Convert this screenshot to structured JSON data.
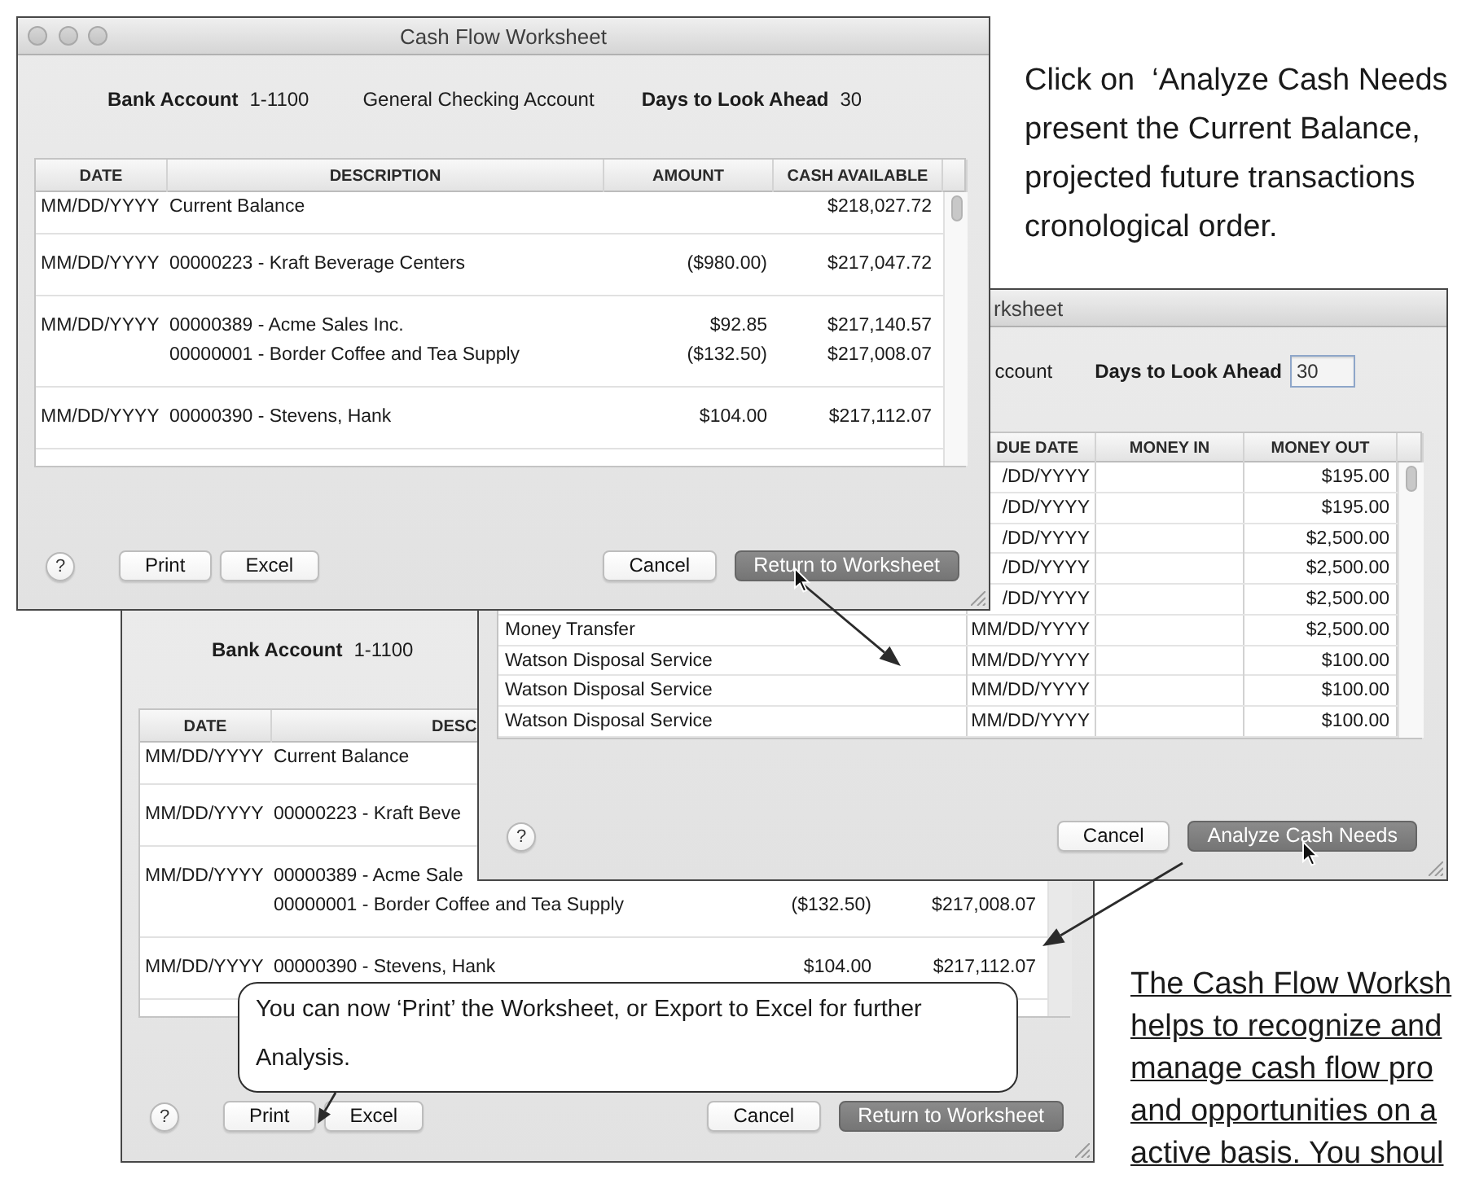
{
  "instruction": {
    "lines": [
      "Click on  ‘Analyze Cash Needs",
      "present the Current Balance,",
      "projected future transactions",
      "cronological order."
    ]
  },
  "worksheet_window": {
    "title": "Cash Flow Worksheet",
    "bank_account_label": "Bank Account",
    "bank_account_number": "1-1100",
    "account_name": "General Checking Account",
    "days_label": "Days to Look Ahead",
    "days_value": "30",
    "columns": [
      "DATE",
      "DESCRIPTION",
      "AMOUNT",
      "CASH AVAILABLE"
    ],
    "rows": [
      {
        "date": "MM/DD/YYYY",
        "entries": [
          {
            "description": "Current Balance",
            "cash_available": "$218,027.72"
          }
        ]
      },
      {
        "date": "MM/DD/YYYY",
        "entries": [
          {
            "description": "00000223 - Kraft Beverage Centers",
            "amount": "($980.00)",
            "cash_available": "$217,047.72"
          }
        ]
      },
      {
        "date": "MM/DD/YYYY",
        "entries": [
          {
            "description": "00000389 - Acme Sales Inc.",
            "amount": "$92.85",
            "cash_available": "$217,140.57"
          },
          {
            "description": "00000001 - Border Coffee and Tea Supply",
            "amount": "($132.50)",
            "cash_available": "$217,008.07"
          }
        ]
      },
      {
        "date": "MM/DD/YYYY",
        "entries": [
          {
            "description": "00000390 - Stevens, Hank",
            "amount": "$104.00",
            "cash_available": "$217,112.07"
          }
        ]
      }
    ],
    "buttons_left": [
      {
        "label": "?",
        "kind": "help"
      },
      {
        "label": "Print",
        "kind": "push"
      },
      {
        "label": "Excel",
        "kind": "push"
      }
    ],
    "buttons_right": [
      {
        "label": "Cancel",
        "kind": "push"
      },
      {
        "label": "Return to Worksheet",
        "kind": "default"
      }
    ]
  },
  "analysis_window": {
    "title": "rksheet",
    "account_name": "ccount",
    "days_label": "Days to Look Ahead",
    "days_value": "30",
    "columns": [
      "DUE DATE",
      "MONEY IN",
      "MONEY OUT"
    ],
    "rows": [
      {
        "due_date": "/DD/YYYY",
        "money_out": "$195.00"
      },
      {
        "due_date": "/DD/YYYY",
        "money_out": "$195.00"
      },
      {
        "due_date": "/DD/YYYY",
        "money_out": "$2,500.00"
      },
      {
        "due_date": "/DD/YYYY",
        "money_out": "$2,500.00"
      },
      {
        "due_date": "/DD/YYYY",
        "money_out": "$2,500.00"
      },
      {
        "description": "Money Transfer",
        "due_date": "MM/DD/YYYY",
        "money_out": "$2,500.00"
      },
      {
        "description": "Watson Disposal Service",
        "due_date": "MM/DD/YYYY",
        "money_out": "$100.00"
      },
      {
        "description": "Watson Disposal Service",
        "due_date": "MM/DD/YYYY",
        "money_out": "$100.00"
      },
      {
        "description": "Watson Disposal Service",
        "due_date": "MM/DD/YYYY",
        "money_out": "$100.00"
      }
    ],
    "buttons_left": [
      {
        "label": "?",
        "kind": "help"
      }
    ],
    "buttons_right": [
      {
        "label": "Cancel",
        "kind": "push"
      },
      {
        "label": "Analyze Cash Needs",
        "kind": "default"
      }
    ]
  },
  "lower_window": {
    "bank_account_label": "Bank Account",
    "bank_account_number": "1-1100",
    "columns": [
      "DATE",
      "DESC"
    ],
    "rows": [
      {
        "date": "MM/DD/YYYY",
        "entries": [
          {
            "description": "Current Balance"
          }
        ]
      },
      {
        "date": "MM/DD/YYYY",
        "entries": [
          {
            "description": "00000223 - Kraft Beve"
          }
        ]
      },
      {
        "date": "MM/DD/YYYY",
        "entries": [
          {
            "description": "00000389 - Acme Sale"
          },
          {
            "description": "00000001 - Border Coffee and Tea Supply",
            "amount": "($132.50)",
            "cash_available": "$217,008.07"
          }
        ]
      },
      {
        "date": "MM/DD/YYYY",
        "entries": [
          {
            "description": "00000390 - Stevens, Hank",
            "amount": "$104.00",
            "cash_available": "$217,112.07"
          }
        ]
      }
    ],
    "buttons_left": [
      {
        "label": "?",
        "kind": "help"
      },
      {
        "label": "Print",
        "kind": "push"
      },
      {
        "label": "Excel",
        "kind": "push"
      }
    ],
    "buttons_right": [
      {
        "label": "Cancel",
        "kind": "push"
      },
      {
        "label": "Return to Worksheet",
        "kind": "default"
      }
    ]
  },
  "callout": {
    "text": "You can now ‘Print’ the Worksheet, or Export to Excel for further Analysis."
  },
  "note": {
    "lines": [
      "The Cash Flow Worksh",
      "helps to recognize and",
      "manage cash flow pro",
      "and opportunities on a",
      "active basis. You shoul"
    ]
  }
}
